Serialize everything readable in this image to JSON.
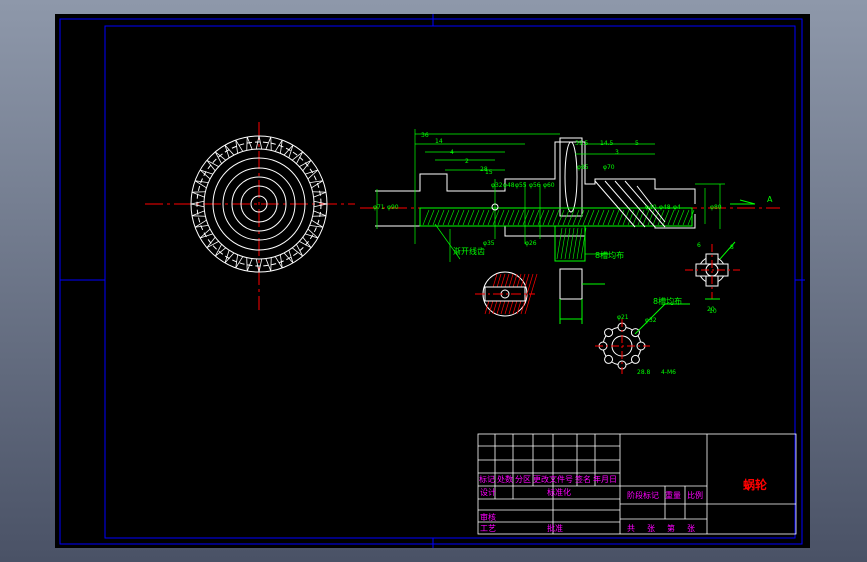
{
  "drawing": {
    "part_name": "蜗轮",
    "colors": {
      "background": "#000000",
      "frame": "#0000ff",
      "outline": "#ffffff",
      "dimension": "#00ff00",
      "centerline": "#ff0000",
      "title_text": "#ff00ff",
      "part_name": "#ff0000"
    },
    "callouts": {
      "spline_tooth": "渐开线齿",
      "pin_hole": "8槽均布",
      "involute_spline": "8槽均布",
      "datum": "A"
    },
    "dims": [
      "φ71",
      "φ90",
      "φ32",
      "φ48",
      "φ55",
      "φ56",
      "φ60",
      "φ85",
      "φ70",
      "φ40",
      "φ48",
      "φ4",
      "φ80",
      "φ35",
      "φ26",
      "φ21",
      "φ32",
      "36",
      "14",
      "4",
      "2",
      "28",
      "15",
      "5",
      "3",
      "14.5",
      "39.5",
      "20",
      "10",
      "6",
      "8",
      "28.8",
      "4-M6"
    ]
  },
  "title_block": {
    "header_row": [
      "标记",
      "处数",
      "分区",
      "更改文件号",
      "签名",
      "年月日"
    ],
    "rows_left": [
      "设计",
      "标准化",
      "审核",
      "工艺",
      "批准"
    ],
    "mid_labels": [
      "阶段标记",
      "重量",
      "比例"
    ],
    "sheet_labels": [
      "共",
      "张",
      "第",
      "张"
    ]
  }
}
